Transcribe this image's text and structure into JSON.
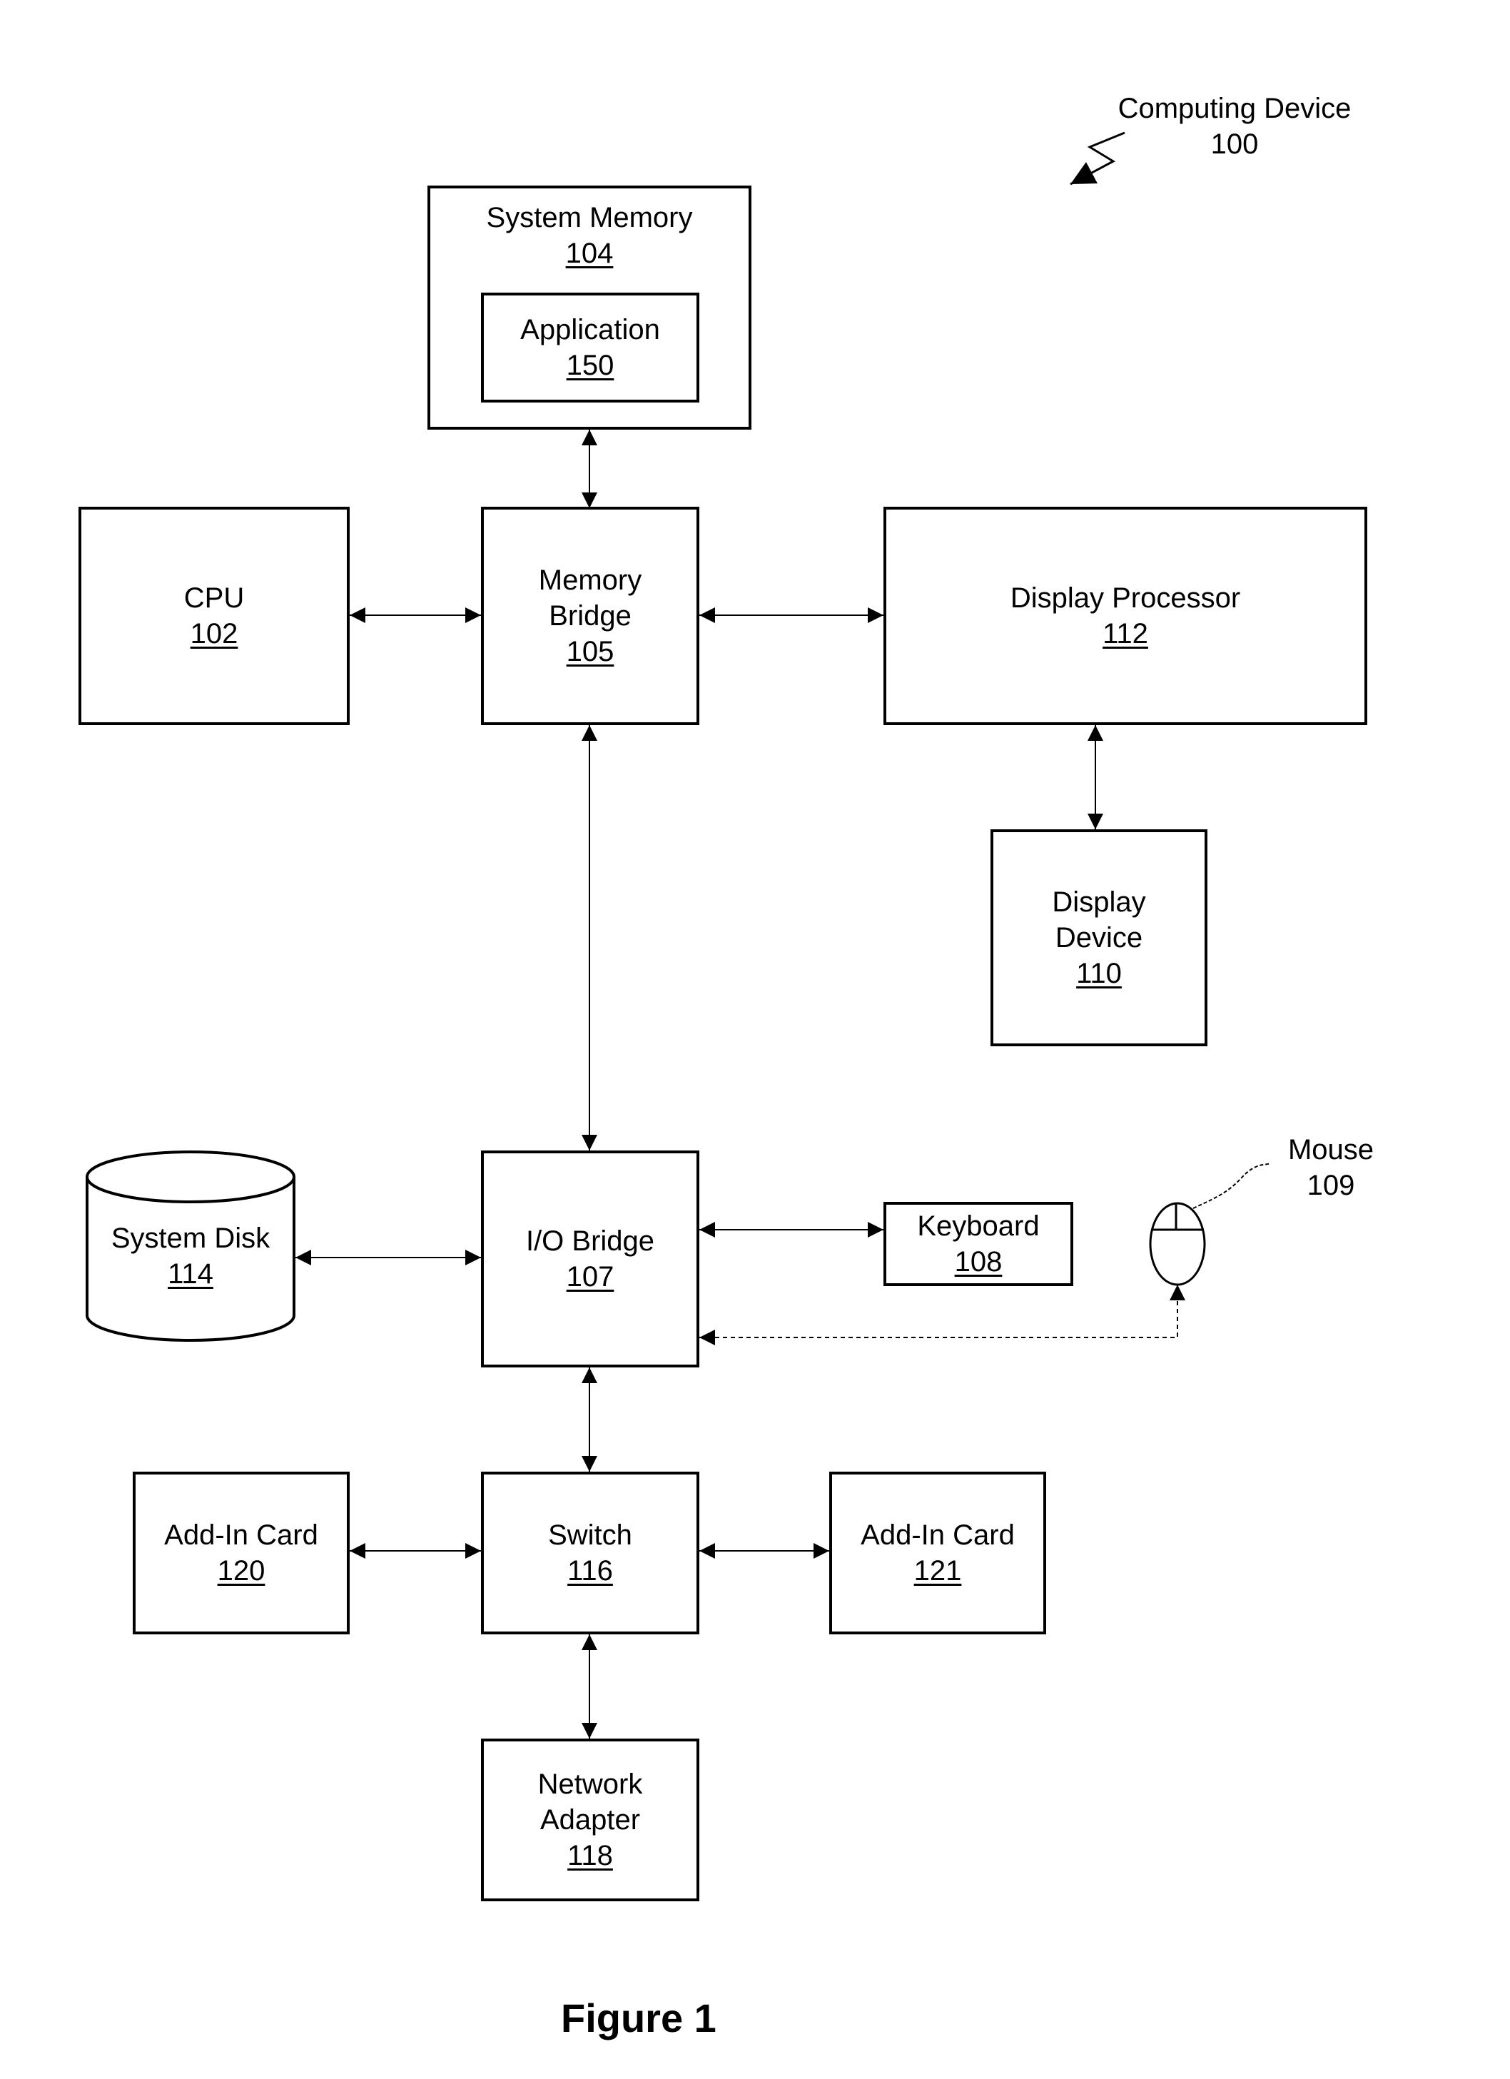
{
  "device": {
    "label": "Computing Device",
    "ref": "100"
  },
  "nodes": {
    "system_memory": {
      "label": "System Memory",
      "ref": "104"
    },
    "application": {
      "label": "Application",
      "ref": "150"
    },
    "cpu": {
      "label": "CPU",
      "ref": "102"
    },
    "memory_bridge": {
      "label_lines": [
        "Memory",
        "Bridge"
      ],
      "ref": "105"
    },
    "display_processor": {
      "label": "Display Processor",
      "ref": "112"
    },
    "display_device": {
      "label_lines": [
        "Display",
        "Device"
      ],
      "ref": "110"
    },
    "system_disk": {
      "label": "System Disk",
      "ref": "114"
    },
    "io_bridge": {
      "label": "I/O Bridge",
      "ref": "107"
    },
    "keyboard": {
      "label": "Keyboard",
      "ref": "108"
    },
    "mouse": {
      "label": "Mouse",
      "ref": "109"
    },
    "add_in_card_120": {
      "label": "Add-In Card",
      "ref": "120"
    },
    "switch": {
      "label": "Switch",
      "ref": "116"
    },
    "add_in_card_121": {
      "label": "Add-In Card",
      "ref": "121"
    },
    "network_adapter": {
      "label_lines": [
        "Network",
        "Adapter"
      ],
      "ref": "118"
    }
  },
  "edges": [
    {
      "from": "system_memory",
      "to": "memory_bridge",
      "style": "solid",
      "directed": "both"
    },
    {
      "from": "cpu",
      "to": "memory_bridge",
      "style": "solid",
      "directed": "both"
    },
    {
      "from": "memory_bridge",
      "to": "display_processor",
      "style": "solid",
      "directed": "both"
    },
    {
      "from": "display_processor",
      "to": "display_device",
      "style": "solid",
      "directed": "both"
    },
    {
      "from": "memory_bridge",
      "to": "io_bridge",
      "style": "solid",
      "directed": "both"
    },
    {
      "from": "system_disk",
      "to": "io_bridge",
      "style": "solid",
      "directed": "both"
    },
    {
      "from": "io_bridge",
      "to": "keyboard",
      "style": "solid",
      "directed": "both"
    },
    {
      "from": "mouse",
      "to": "io_bridge",
      "style": "dotted",
      "directed": "both"
    },
    {
      "from": "io_bridge",
      "to": "switch",
      "style": "solid",
      "directed": "both"
    },
    {
      "from": "add_in_card_120",
      "to": "switch",
      "style": "solid",
      "directed": "both"
    },
    {
      "from": "switch",
      "to": "add_in_card_121",
      "style": "solid",
      "directed": "both"
    },
    {
      "from": "switch",
      "to": "network_adapter",
      "style": "solid",
      "directed": "both"
    }
  ],
  "caption": "Figure 1"
}
